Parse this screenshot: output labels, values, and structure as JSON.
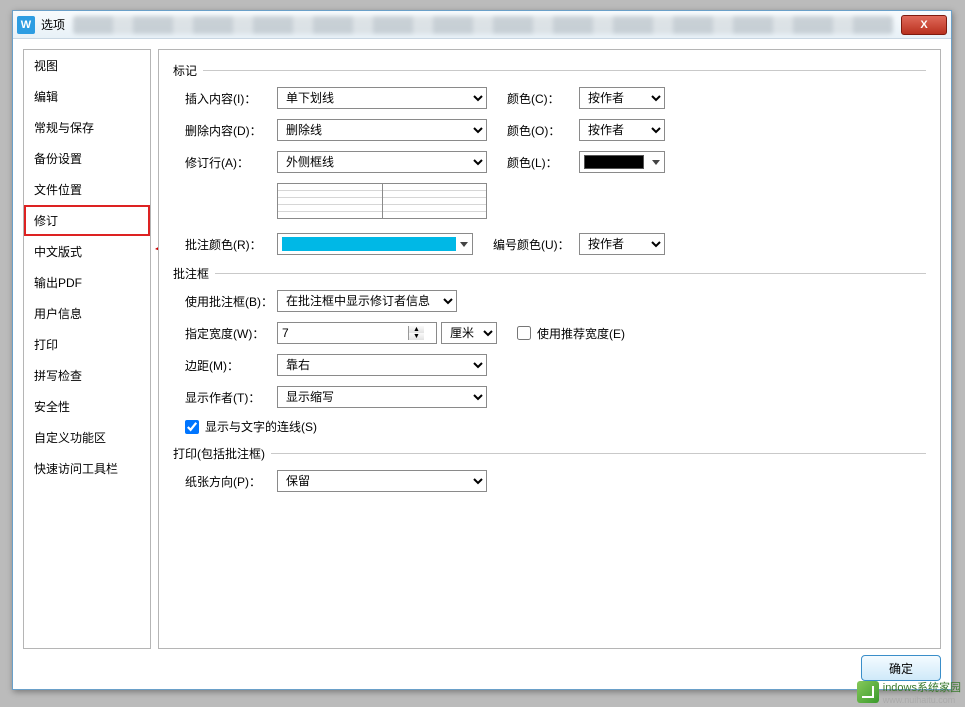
{
  "title": "选项",
  "closeX": "X",
  "sidebar": {
    "items": [
      {
        "label": "视图"
      },
      {
        "label": "编辑"
      },
      {
        "label": "常规与保存"
      },
      {
        "label": "备份设置"
      },
      {
        "label": "文件位置"
      },
      {
        "label": "修订",
        "selected": true
      },
      {
        "label": "中文版式"
      },
      {
        "label": "输出PDF"
      },
      {
        "label": "用户信息"
      },
      {
        "label": "打印"
      },
      {
        "label": "拼写检查"
      },
      {
        "label": "安全性"
      },
      {
        "label": "自定义功能区"
      },
      {
        "label": "快速访问工具栏"
      }
    ]
  },
  "groups": {
    "mark": {
      "title": "标记",
      "insert_lbl": "插入内容(I)：",
      "insert_val": "单下划线",
      "delete_lbl": "删除内容(D)：",
      "delete_val": "删除线",
      "revline_lbl": "修订行(A)：",
      "revline_val": "外侧框线",
      "colorC_lbl": "颜色(C)：",
      "colorC_val": "按作者",
      "colorO_lbl": "颜色(O)：",
      "colorO_val": "按作者",
      "colorL_lbl": "颜色(L)：",
      "commentcolor_lbl": "批注颜色(R)：",
      "numcolor_lbl": "编号颜色(U)：",
      "numcolor_val": "按作者"
    },
    "balloon": {
      "title": "批注框",
      "use_lbl": "使用批注框(B)：",
      "use_val": "在批注框中显示修订者信息",
      "width_lbl": "指定宽度(W)：",
      "width_val": "7",
      "width_unit": "厘米",
      "recw_lbl": "使用推荐宽度(E)",
      "margin_lbl": "边距(M)：",
      "margin_val": "靠右",
      "author_lbl": "显示作者(T)：",
      "author_val": "显示缩写",
      "connline_lbl": "显示与文字的连线(S)"
    },
    "print": {
      "title": "打印(包括批注框)",
      "orient_lbl": "纸张方向(P)：",
      "orient_val": "保留"
    }
  },
  "footer": {
    "ok": "确定"
  },
  "watermark": {
    "text": "indows系统家园",
    "url": "www.nuihaitu.com"
  }
}
